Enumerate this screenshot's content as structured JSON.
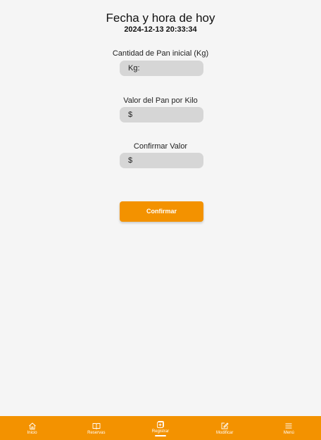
{
  "header": {
    "title": "Fecha y hora de hoy",
    "datetime": "2024-12-13 20:33:34"
  },
  "form": {
    "fields": [
      {
        "label": "Cantidad de Pan inicial (Kg)",
        "value": "Kg:"
      },
      {
        "label": "Valor del Pan por Kilo",
        "value": "$"
      },
      {
        "label": "Confirmar Valor",
        "value": "$"
      }
    ],
    "confirm_label": "Confirmar"
  },
  "bottom_nav": {
    "items": [
      {
        "label": "Inicio",
        "icon": "home-icon"
      },
      {
        "label": "Reservas",
        "icon": "book-icon"
      },
      {
        "label": "Registrar",
        "icon": "add-box-icon",
        "active": true
      },
      {
        "label": "Modificar",
        "icon": "edit-icon"
      },
      {
        "label": "Menú",
        "icon": "menu-icon"
      }
    ]
  },
  "colors": {
    "accent": "#f39200",
    "background": "#f5f5f5",
    "input_bg": "#d6d6d6"
  }
}
